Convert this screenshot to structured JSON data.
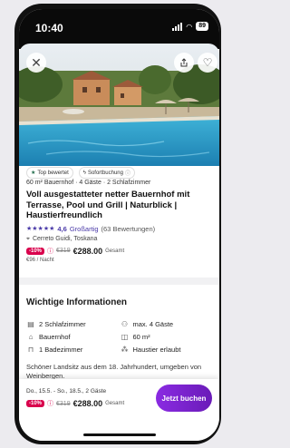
{
  "status": {
    "time": "10:40",
    "battery": "89"
  },
  "badges": {
    "top_rated": "Top bewertet",
    "instant_booking": "Sofortbuchung"
  },
  "listing": {
    "meta": "60 m² Bauernhof · 4 Gäste · 2 Schlafzimmer",
    "title": "Voll ausgestatteter netter Bauernhof mit Terrasse, Pool und Grill | Naturblick | Haustierfreundlich",
    "stars": "★★★★★",
    "score": "4,6",
    "grade": "Großartig",
    "reviews": "(63 Bewertungen)",
    "location": "Cerreto Guidi, Toskana",
    "discount": "-10%",
    "old_price": "€319",
    "new_price": "€288.00",
    "total_label": "Gesamt",
    "per_night": "€96 / Nacht"
  },
  "info": {
    "title": "Wichtige Informationen",
    "items": [
      {
        "icon": "bed-icon",
        "label": "2 Schlafzimmer"
      },
      {
        "icon": "guests-icon",
        "label": "max. 4 Gäste"
      },
      {
        "icon": "house-icon",
        "label": "Bauernhof"
      },
      {
        "icon": "area-icon",
        "label": "60 m²"
      },
      {
        "icon": "bath-icon",
        "label": "1 Badezimmer"
      },
      {
        "icon": "paw-icon",
        "label": "Haustier erlaubt"
      }
    ],
    "description": "Schöner Landsitz aus dem 18. Jahrhundert, umgeben von Weinbergen."
  },
  "booking": {
    "dates": "Do., 15.5. - So., 18.5., 2 Gäste",
    "discount": "-10%",
    "old_price": "€319",
    "new_price": "€288.00",
    "total_label": "Gesamt",
    "button": "Jetzt buchen"
  },
  "colors": {
    "accent": "#4a3aa8",
    "discount": "#d9004c",
    "button": "#7b23d0"
  }
}
